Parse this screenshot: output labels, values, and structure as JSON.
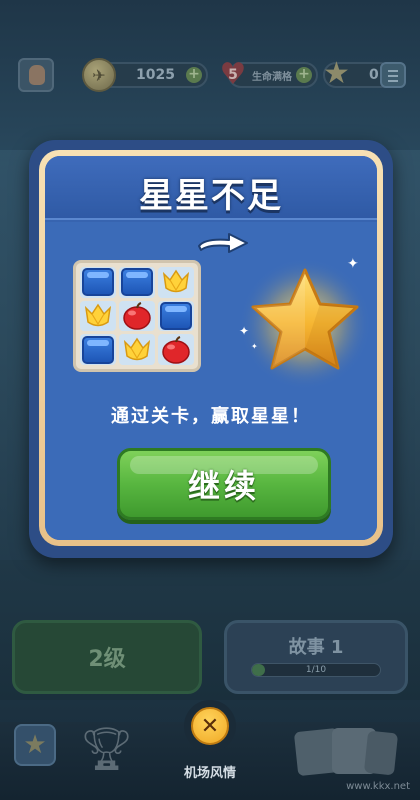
{
  "hud": {
    "coins": "1025",
    "lives_count": "5",
    "lives_label": "生命满格",
    "stars": "0"
  },
  "dialog": {
    "title": "星星不足",
    "message": "通过关卡，赢取星星！",
    "continue_label": "继续",
    "board_tiles": [
      "box",
      "box",
      "tulip",
      "tulip",
      "apple",
      "box",
      "box",
      "tulip",
      "apple"
    ]
  },
  "lower": {
    "level_label": "2级",
    "story_label": "故事 1",
    "story_progress_text": "1/10",
    "story_progress": 0.1
  },
  "bottom_nav": {
    "active_label": "机场风情"
  },
  "watermark": "www.kkx.net",
  "colors": {
    "dialog_bg": "#3764b0",
    "frame": "#e8c189",
    "button_green": "#58b640",
    "close_button": "#f0a824"
  },
  "icons": {
    "hud": [
      "avatar-icon",
      "coin-icon",
      "heart-icon",
      "star-icon",
      "menu-icon"
    ],
    "dialog": [
      "arrow-icon",
      "star-icon",
      "sparkle-icon"
    ],
    "bottom_nav": [
      "profile-icon",
      "trophy-icon",
      "close-icon",
      "cards-icon"
    ]
  }
}
